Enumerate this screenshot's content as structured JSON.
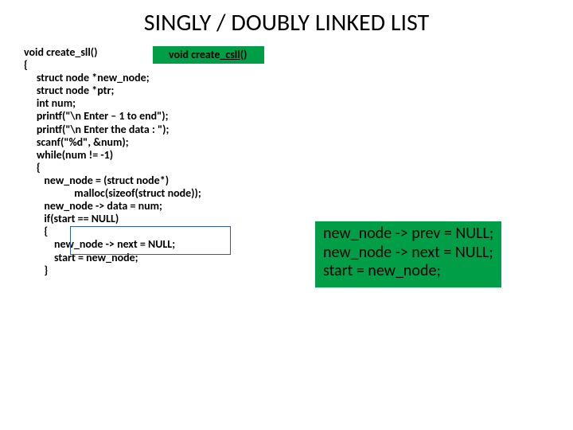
{
  "title": "SINGLY / DOUBLY LINKED LIST",
  "code": {
    "l01": "void create_sll()",
    "l02": "{",
    "l03": "     struct node *new_node;",
    "l04": "     struct node *ptr;",
    "l05": "     int num;",
    "l06": "     printf(\"\\n Enter – 1 to end\");",
    "l07": "     printf(\"\\n Enter the data : \");",
    "l08": "     scanf(\"%d\", &num);",
    "l09": "     while(num != -1)",
    "l10": "     {",
    "l11": "        new_node = (struct node*)",
    "l12": "                    malloc(sizeof(struct node));",
    "l13": "        new_node -> data = num;",
    "l14": "        if(start == NULL)",
    "l15": "        {",
    "l16": "            new_node -> next = NULL;",
    "l17": "            start = new_node;",
    "l18": "        }"
  },
  "box1": {
    "pre": "void create_",
    "u": "csll",
    "post": "()"
  },
  "box2": {
    "l1": "new_node -> prev = NULL;",
    "l2": "new_node -> next = NULL;",
    "l3": "start = new_node;"
  }
}
